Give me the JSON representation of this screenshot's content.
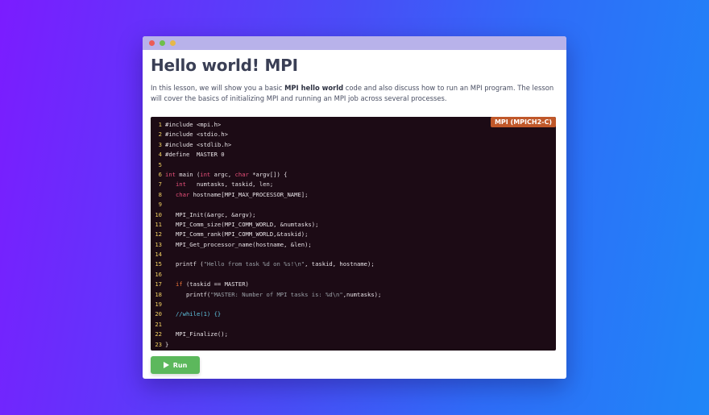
{
  "window": {
    "title": "Hello world! MPI",
    "desc_before": "In this lesson, we will show you a basic ",
    "desc_bold": "MPI hello world",
    "desc_after": " code and also discuss how to run an MPI program. The lesson will cover the basics of initializing MPI and running an MPI job across several processes."
  },
  "editor": {
    "language_badge": "MPI (MPICH2-C)",
    "colors": {
      "keyword": "#f2763a",
      "type": "#e8507a",
      "string": "#9aa0a6",
      "comment": "#5ec4e0",
      "line_number": "#f0d060"
    },
    "lines": [
      [
        [
          "t",
          "#include <mpi.h>"
        ]
      ],
      [
        [
          "t",
          "#include <stdio.h>"
        ]
      ],
      [
        [
          "t",
          "#include <stdlib.h>"
        ]
      ],
      [
        [
          "t",
          "#define  MASTER 0"
        ]
      ],
      [],
      [
        [
          "ty",
          "int"
        ],
        [
          "t",
          " main ("
        ],
        [
          "ty",
          "int"
        ],
        [
          "t",
          " argc, "
        ],
        [
          "ty",
          "char"
        ],
        [
          "t",
          " *argv[]) {"
        ]
      ],
      [
        [
          "t",
          "   "
        ],
        [
          "ty",
          "int"
        ],
        [
          "t",
          "   numtasks, taskid, len;"
        ]
      ],
      [
        [
          "t",
          "   "
        ],
        [
          "ty",
          "char"
        ],
        [
          "t",
          " hostname[MPI_MAX_PROCESSOR_NAME];"
        ]
      ],
      [],
      [
        [
          "t",
          "   MPI_Init(&argc, &argv);"
        ]
      ],
      [
        [
          "t",
          "   MPI_Comm_size(MPI_COMM_WORLD, &numtasks);"
        ]
      ],
      [
        [
          "t",
          "   MPI_Comm_rank(MPI_COMM_WORLD,&taskid);"
        ]
      ],
      [
        [
          "t",
          "   MPI_Get_processor_name(hostname, &len);"
        ]
      ],
      [],
      [
        [
          "t",
          "   printf ("
        ],
        [
          "str",
          "\"Hello from task %d on %s!\\n\""
        ],
        [
          "t",
          ", taskid, hostname);"
        ]
      ],
      [],
      [
        [
          "t",
          "   "
        ],
        [
          "kw",
          "if"
        ],
        [
          "t",
          " (taskid == MASTER)"
        ]
      ],
      [
        [
          "t",
          "      printf("
        ],
        [
          "str",
          "\"MASTER: Number of MPI tasks is: %d\\n\""
        ],
        [
          "t",
          ",numtasks);"
        ]
      ],
      [],
      [
        [
          "t",
          "   "
        ],
        [
          "cm",
          "//while(1) {}"
        ]
      ],
      [],
      [
        [
          "t",
          "   MPI_Finalize();"
        ]
      ],
      [
        [
          "t",
          "}"
        ]
      ]
    ]
  },
  "run_button": {
    "label": "Run",
    "icon": "play-icon",
    "color": "#5cb85c"
  }
}
